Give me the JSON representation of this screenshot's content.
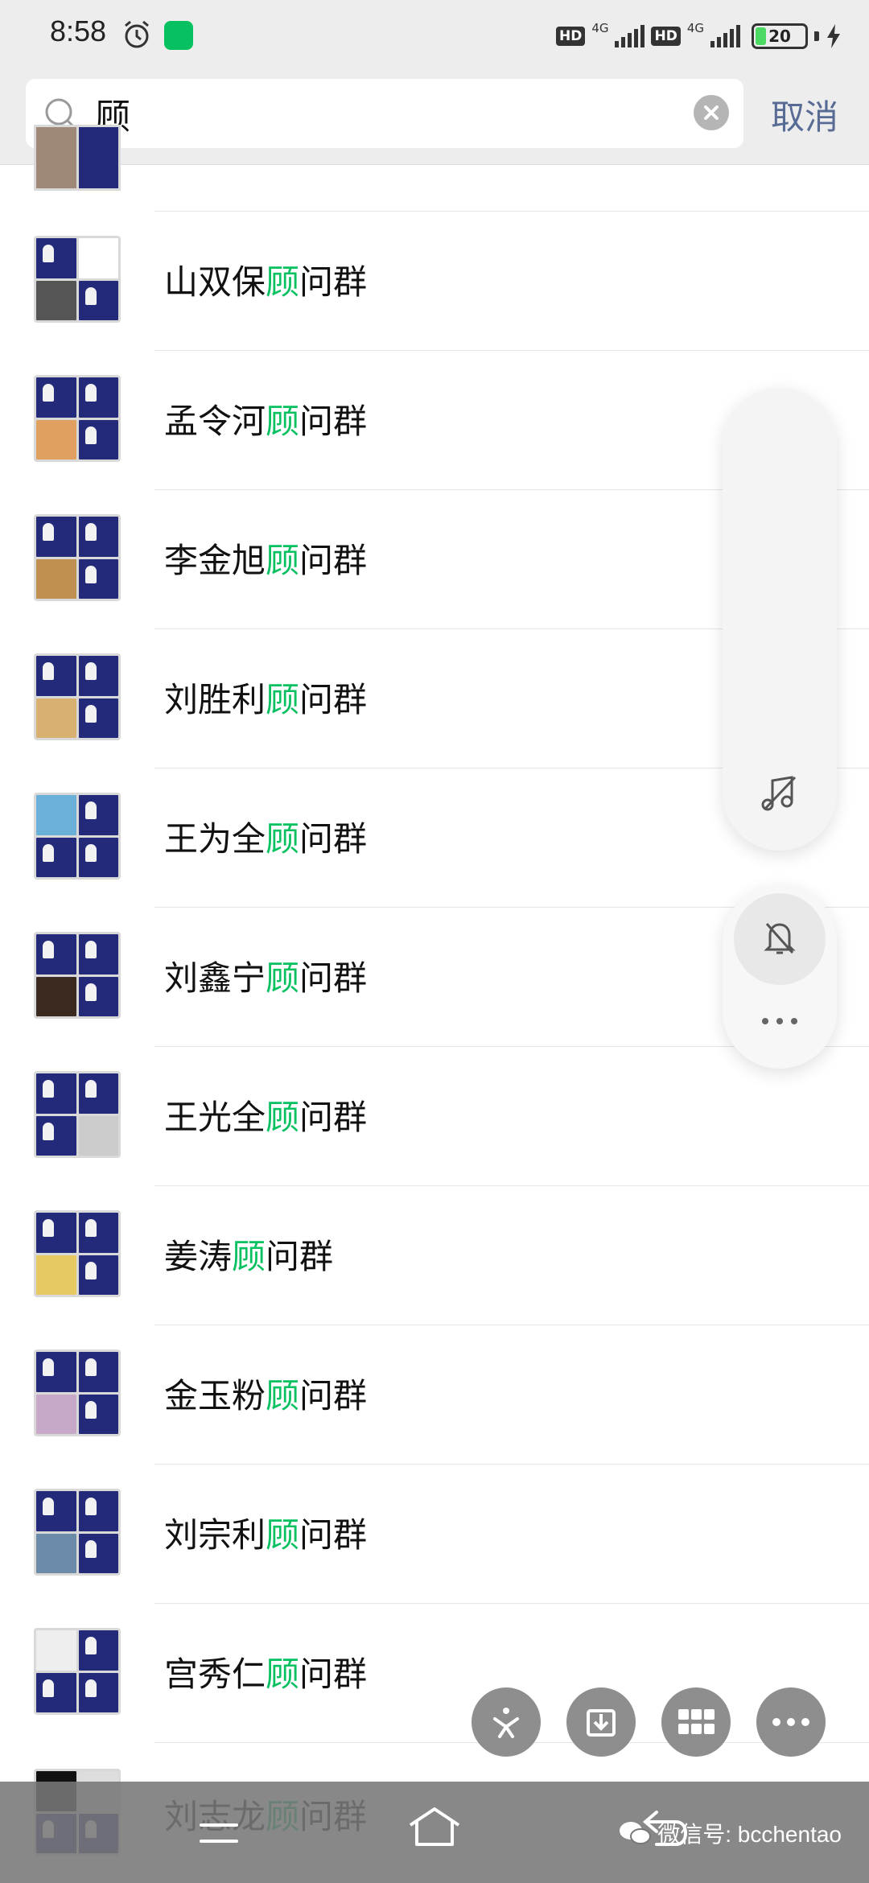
{
  "status_bar": {
    "time": "8:58",
    "network_hd_1": "HD",
    "network_gen_1": "4G",
    "network_hd_2": "HD",
    "network_gen_2": "4G",
    "battery_level": "20"
  },
  "search": {
    "query": "顾",
    "cancel_label": "取消"
  },
  "results": [
    {
      "prefix": "山双保",
      "match": "顾",
      "suffix": "问群"
    },
    {
      "prefix": "孟令河",
      "match": "顾",
      "suffix": "问群"
    },
    {
      "prefix": "李金旭",
      "match": "顾",
      "suffix": "问群"
    },
    {
      "prefix": "刘胜利",
      "match": "顾",
      "suffix": "问群"
    },
    {
      "prefix": "王为全",
      "match": "顾",
      "suffix": "问群"
    },
    {
      "prefix": "刘鑫宁",
      "match": "顾",
      "suffix": "问群"
    },
    {
      "prefix": "王光全",
      "match": "顾",
      "suffix": "问群"
    },
    {
      "prefix": "姜涛",
      "match": "顾",
      "suffix": "问群"
    },
    {
      "prefix": "金玉粉",
      "match": "顾",
      "suffix": "问群"
    },
    {
      "prefix": "刘宗利",
      "match": "顾",
      "suffix": "问群"
    },
    {
      "prefix": "宫秀仁",
      "match": "顾",
      "suffix": "问群"
    },
    {
      "prefix": "刘志龙",
      "match": "顾",
      "suffix": "问群"
    }
  ],
  "watermark": "微信号: bcchentao",
  "colors": {
    "highlight": "#07c160",
    "link": "#576b95",
    "avatar_tile": "#232a7a"
  },
  "icons": {
    "float_panel": [
      "music-off-icon",
      "mute-bell-icon",
      "more-dots-icon"
    ],
    "action_bar": [
      "sparkle-icon",
      "download-icon",
      "grid-icon",
      "more-icon"
    ],
    "nav": [
      "menu-icon",
      "home-icon",
      "back-icon"
    ]
  }
}
